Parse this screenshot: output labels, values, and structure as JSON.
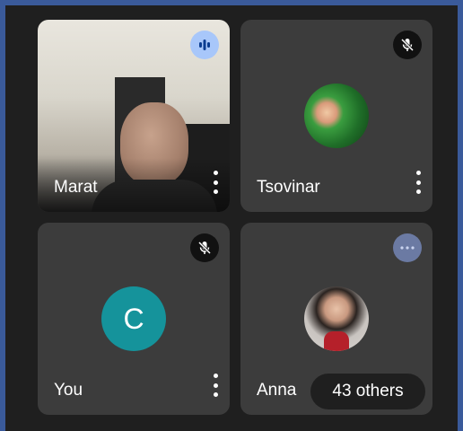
{
  "participants": [
    {
      "name": "Marat",
      "status": "speaking",
      "status_icon": "audio-bars-icon"
    },
    {
      "name": "Tsovinar",
      "status": "muted",
      "status_icon": "mic-off-icon"
    },
    {
      "name": "You",
      "status": "muted",
      "status_icon": "mic-off-icon",
      "avatar_letter": "C",
      "avatar_color": "#15939b"
    },
    {
      "name": "Anna",
      "status": "more",
      "status_icon": "ellipsis-icon"
    }
  ],
  "others": {
    "label": "43 others"
  },
  "colors": {
    "tile": "#3c3c3c",
    "background": "#1f1f1f",
    "speaking": "#a8c7fa"
  }
}
